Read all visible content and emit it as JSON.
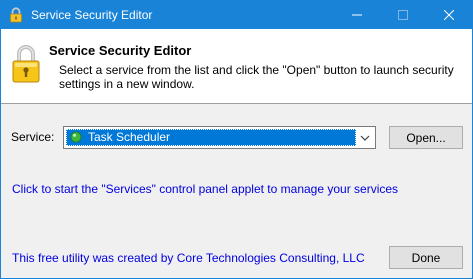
{
  "window": {
    "title": "Service Security Editor",
    "icon": "lock-icon",
    "accent_color": "#1883d7",
    "controls": [
      "minimize-icon",
      "maximize-icon",
      "close-icon"
    ]
  },
  "header": {
    "title": "Service Security Editor",
    "description": "Select a service from the list and click the \"Open\" button to launch security settings in a new window.",
    "icon": "padlock-icon"
  },
  "service": {
    "label": "Service:",
    "selected": "Task Scheduler",
    "status_icon": "green-status-icon",
    "open_button": "Open..."
  },
  "links": {
    "services_applet": "Click to start the \"Services\" control panel applet to manage your services",
    "credit": "This free utility was created by Core Technologies Consulting, LLC",
    "color": "#0000e0"
  },
  "footer": {
    "done_button": "Done"
  }
}
